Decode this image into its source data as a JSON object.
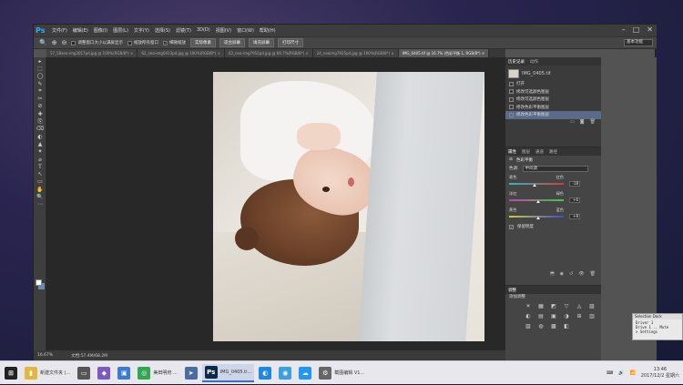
{
  "app": {
    "logo": "Ps",
    "menu": [
      "文件(F)",
      "编辑(E)",
      "图像(I)",
      "图层(L)",
      "文字(Y)",
      "选择(S)",
      "滤镜(T)",
      "3D(D)",
      "视图(V)",
      "窗口(W)",
      "帮助(H)"
    ],
    "window_controls": [
      "–",
      "□",
      "✕"
    ]
  },
  "options_bar": {
    "checks": [
      {
        "label": "调整窗口大小以满屏显示",
        "checked": false
      },
      {
        "label": "缩放所有窗口",
        "checked": false
      },
      {
        "label": "细微缩放",
        "checked": true
      }
    ],
    "buttons": [
      "实际像素",
      "适合屏幕",
      "填充屏幕",
      "打印尺寸"
    ],
    "workspace": "基本功能"
  },
  "tabs": [
    {
      "label": "57_58xeo-img3017pd.jpg @ 100%(RGB/8*)",
      "active": false
    },
    {
      "label": "62_neo-img0413pd.jpg @ 100%(RGB/8*)",
      "active": false
    },
    {
      "label": "62_neo-img7952pd.jpg @ 66.7%(RGB/8*)",
      "active": false
    },
    {
      "label": "24_neoimg7925pd.jpg @ 100%(RGB/8*)",
      "active": false
    },
    {
      "label": "IMG_0405.tif @ 16.7% (色彩平衡 1, RGB/8*)",
      "active": true
    }
  ],
  "tools": [
    "▸",
    "⬚",
    "◯",
    "✎",
    "⌗",
    "✂",
    "⊘",
    "✚",
    "⎘",
    "⌫",
    "◐",
    "▲",
    "✦",
    "⌀",
    "T",
    "↖",
    "▭",
    "✋",
    "🔍",
    "⋯"
  ],
  "status": {
    "zoom": "16.67%",
    "doc": "文档:57.4M/68.2M"
  },
  "history": {
    "tabs": [
      "历史记录",
      "动作"
    ],
    "snapshot": "IMG_0405.tif",
    "items": [
      {
        "label": "打开",
        "selected": false
      },
      {
        "label": "修改可选颜色图层",
        "selected": false
      },
      {
        "label": "修改可选颜色图层",
        "selected": false
      },
      {
        "label": "修改色彩平衡图层",
        "selected": false
      },
      {
        "label": "修改色彩平衡图层",
        "selected": true
      }
    ]
  },
  "properties": {
    "tabs": [
      "属性",
      "图层",
      "通道",
      "路径"
    ],
    "title": "色彩平衡",
    "tone_label": "色调:",
    "tone_value": "中间调",
    "sliders": [
      {
        "left": "青色",
        "right": "红色",
        "value": "-18",
        "pos": 0.46,
        "gradient": "linear-gradient(90deg,#2ab7c9,#d23b3b)"
      },
      {
        "left": "洋红",
        "right": "绿色",
        "value": "+6",
        "pos": 0.53,
        "gradient": "linear-gradient(90deg,#c93fb0,#3fc94a)"
      },
      {
        "left": "黄色",
        "right": "蓝色",
        "value": "+8",
        "pos": 0.54,
        "gradient": "linear-gradient(90deg,#d2c93a,#3a4fd2)"
      }
    ],
    "preserve": "保留明度"
  },
  "adjustments": {
    "title": "调整",
    "subtitle": "添加调整",
    "icons": [
      "☀",
      "▦",
      "◩",
      "▽",
      "◬",
      "▧",
      "◐",
      "▤",
      "▣",
      "◑",
      "⊞",
      "▥",
      "▨",
      "◍",
      "▩",
      "◧"
    ]
  },
  "dialog": {
    "title": "Selection Dock",
    "lines": [
      "Driver 1",
      "Drive 1  ..  Mute",
      "> Settings"
    ]
  },
  "taskbar": {
    "items": [
      {
        "label": "新建文件夹 (...",
        "icon_bg": "#e3b73b",
        "glyph": "▮"
      },
      {
        "label": "",
        "icon_bg": "#555",
        "glyph": "▭"
      },
      {
        "label": "",
        "icon_bg": "#7b5ac7",
        "glyph": "◆"
      },
      {
        "label": "",
        "icon_bg": "#3a7bd5",
        "glyph": "▣"
      },
      {
        "label": "美田明府 ...",
        "icon_bg": "#2fa84f",
        "glyph": "◎"
      },
      {
        "label": "",
        "icon_bg": "#4b6ba3",
        "glyph": "➤"
      },
      {
        "label": "IMG_0405.ti...",
        "icon_bg": "#0b2a4a",
        "glyph": "Ps",
        "active": true
      },
      {
        "label": "",
        "icon_bg": "#1e88e5",
        "glyph": "◐"
      },
      {
        "label": "",
        "icon_bg": "#3aa0e0",
        "glyph": "◉"
      },
      {
        "label": "",
        "icon_bg": "#2196f3",
        "glyph": "☁"
      },
      {
        "label": "截图编辑 V1...",
        "icon_bg": "#666",
        "glyph": "⚙"
      }
    ],
    "clock_time": "13:46",
    "clock_date": "2017/12/2 星期六"
  }
}
